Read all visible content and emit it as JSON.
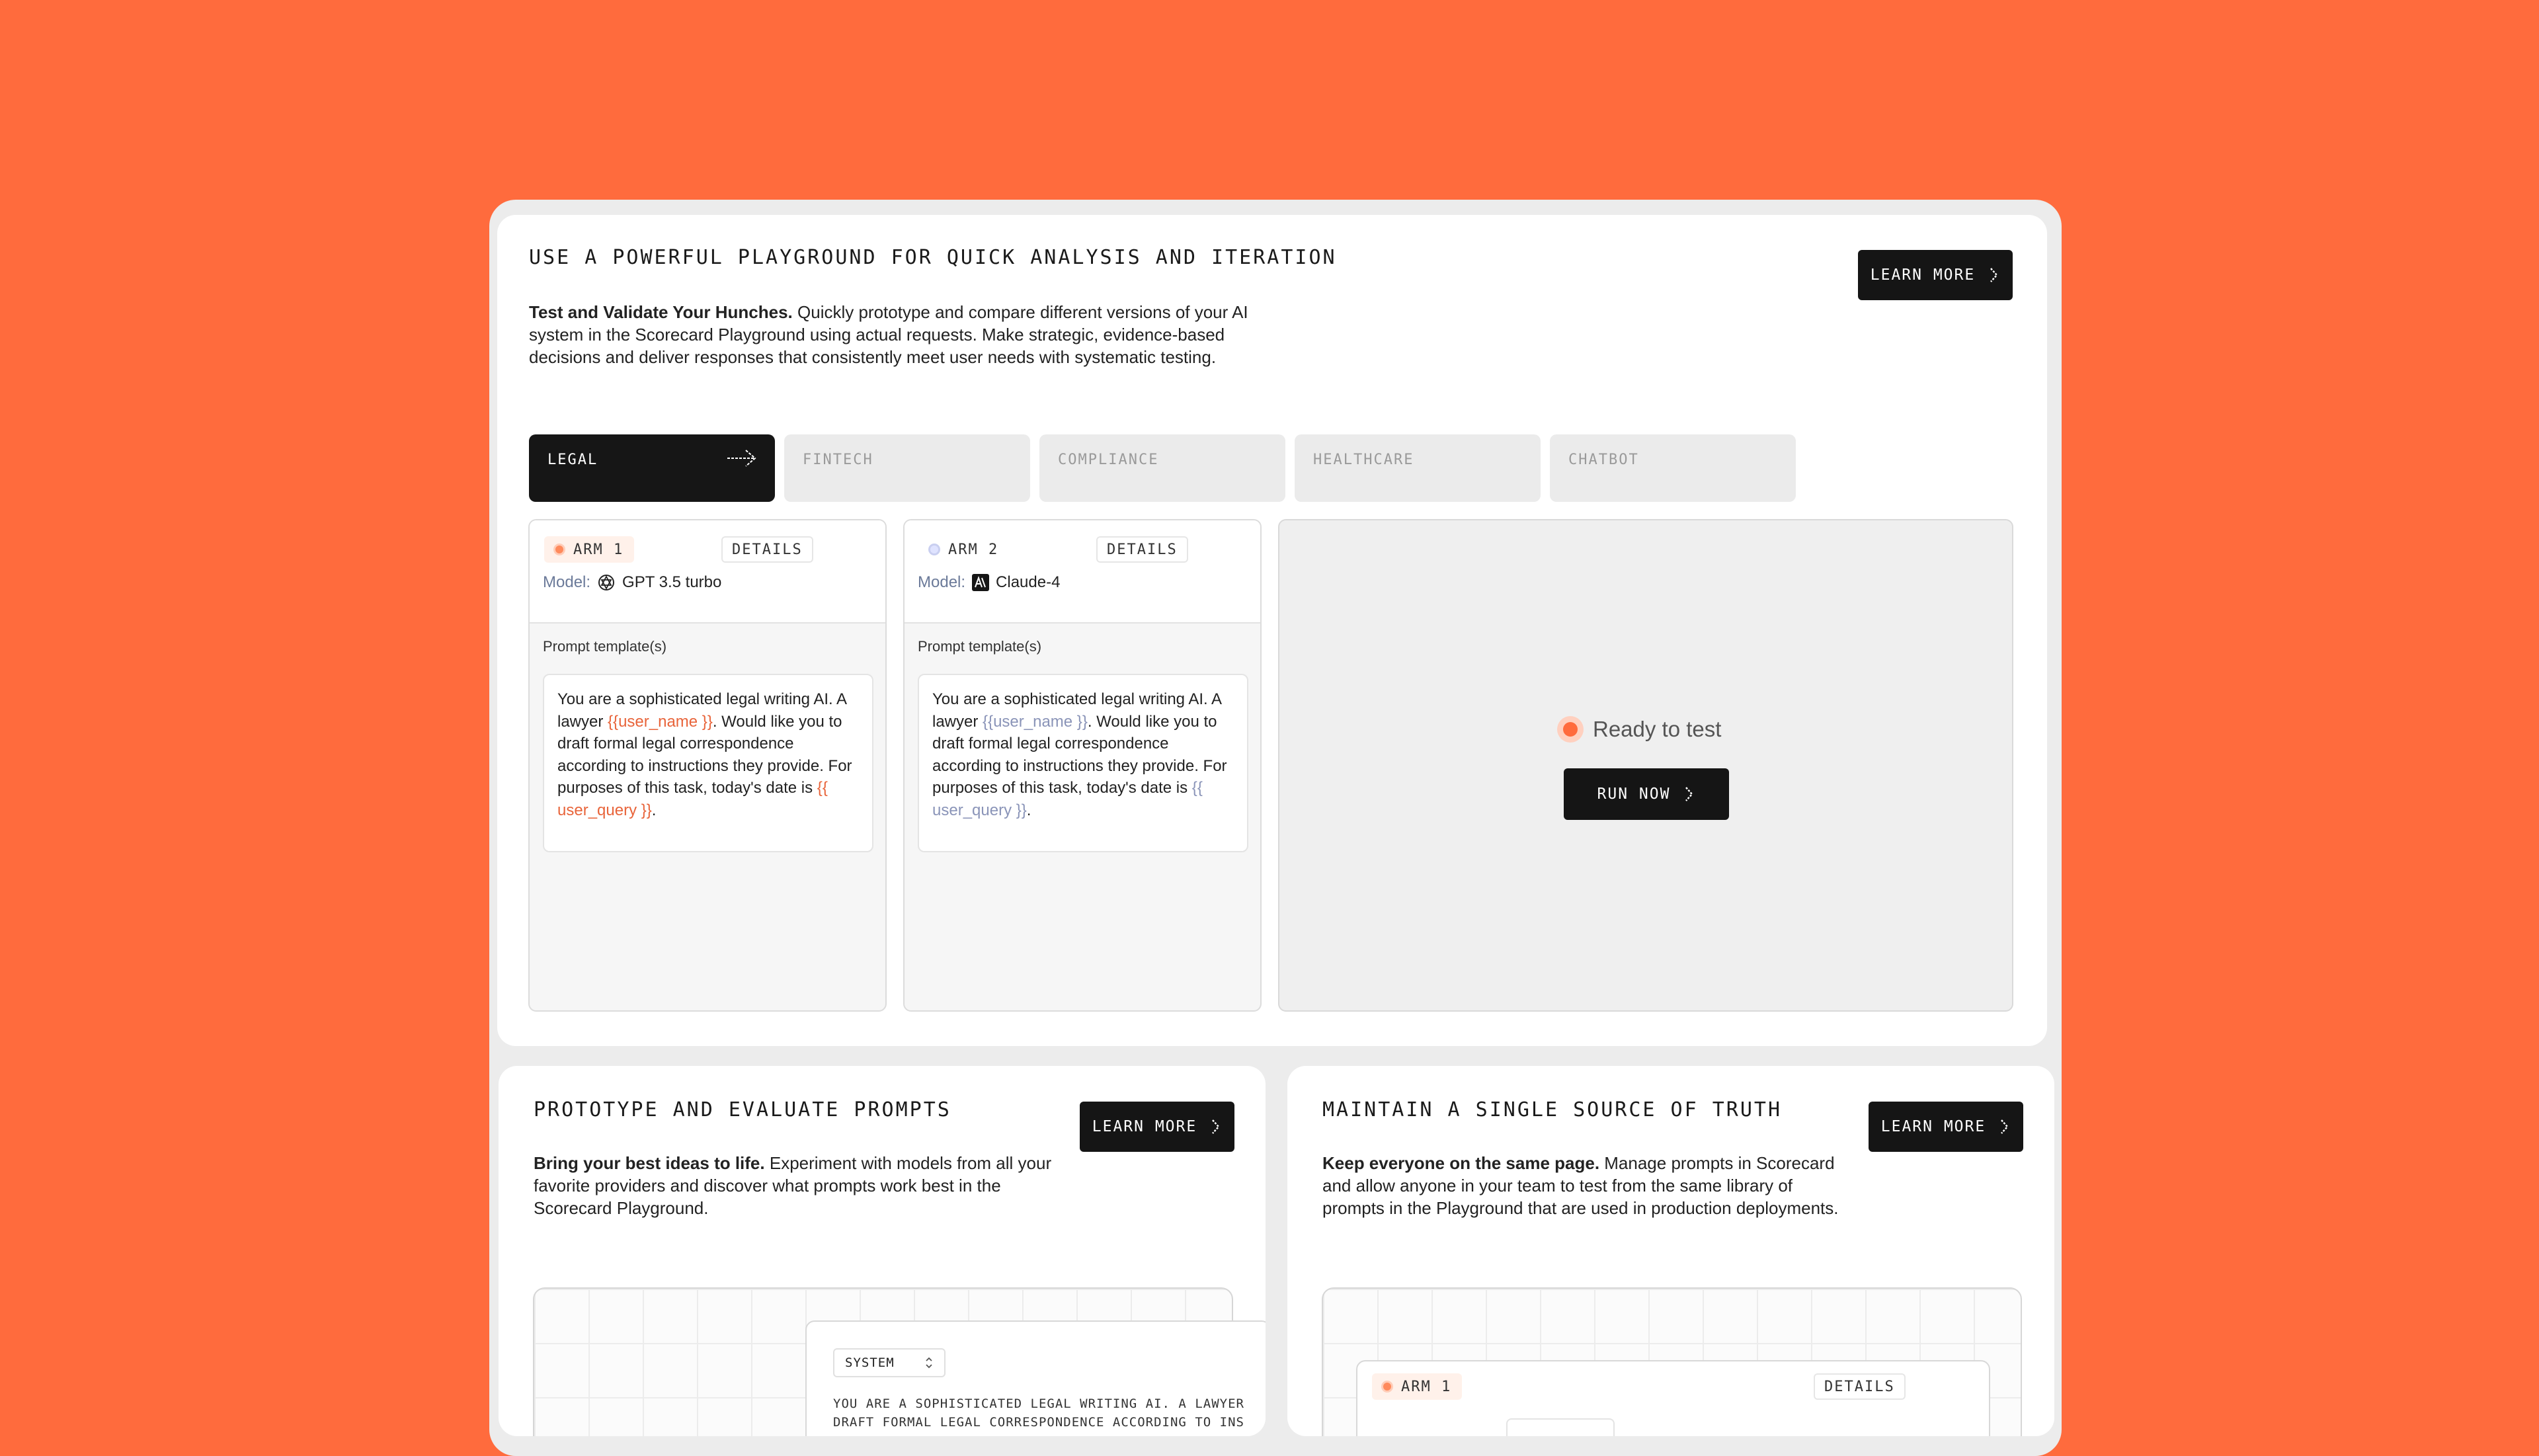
{
  "main": {
    "title": "USE A POWERFUL PLAYGROUND FOR QUICK ANALYSIS AND ITERATION",
    "lead_bold": "Test and Validate Your Hunches.",
    "lead_text": " Quickly prototype and compare different versions of your AI system in the Scorecard Playground using actual requests. Make strategic, evidence-based decisions and deliver responses that consistently meet user needs with systematic testing.",
    "learn_more": "LEARN MORE"
  },
  "tabs": [
    {
      "label": "LEGAL",
      "active": true
    },
    {
      "label": "FINTECH",
      "active": false
    },
    {
      "label": "COMPLIANCE",
      "active": false
    },
    {
      "label": "HEALTHCARE",
      "active": false
    },
    {
      "label": "CHATBOT",
      "active": false
    }
  ],
  "arms": [
    {
      "badge": "ARM 1",
      "details": "DETAILS",
      "model_label": "Model:",
      "model_name": "GPT 3.5 turbo",
      "model_icon": "openai-icon",
      "prompt_label": "Prompt template(s)",
      "prompt_parts": [
        "You are a sophisticated legal writing AI. A lawyer ",
        "{{user_name }}",
        ". Would like you to draft formal legal correspondence according to instructions they provide. For purposes of this task, today's date is ",
        "{{ user_query }}",
        "."
      ],
      "accent": "#e8643a",
      "dot": "#ff8a5c"
    },
    {
      "badge": "ARM 2",
      "details": "DETAILS",
      "model_label": "Model:",
      "model_name": "Claude-4",
      "model_icon": "anthropic-icon",
      "prompt_label": "Prompt template(s)",
      "prompt_parts": [
        "You are a sophisticated legal writing AI. A lawyer ",
        "{{user_name }}",
        ". Would like you to draft formal legal correspondence according to instructions they provide. For purposes of this task, today's date is ",
        "{{ user_query }}",
        "."
      ],
      "accent": "#8a94b8",
      "dot": "#c9cff0"
    }
  ],
  "runner": {
    "status": "Ready to test",
    "run_label": "RUN NOW"
  },
  "card_prototype": {
    "title": "PROTOTYPE AND EVALUATE PROMPTS",
    "lead_bold": "Bring your best ideas to life.",
    "lead_text": " Experiment with models from all your favorite providers and discover what prompts work best in the Scorecard Playground.",
    "learn_more": "LEARN MORE",
    "role_select": "SYSTEM",
    "snippet_line1": "YOU ARE A SOPHISTICATED LEGAL WRITING AI. A LAWYER",
    "snippet_line2": "DRAFT FORMAL LEGAL CORRESPONDENCE ACCORDING TO INS"
  },
  "card_truth": {
    "title": "MAINTAIN A SINGLE SOURCE OF TRUTH",
    "lead_bold": "Keep everyone on the same page.",
    "lead_text": " Manage prompts in Scorecard and allow anyone in your team to test from the same library of prompts in the Playground that are used in production deployments.",
    "learn_more": "LEARN MORE",
    "arm_badge": "ARM 1",
    "details": "DETAILS"
  },
  "colors": {
    "background": "#ff6b3d",
    "dark": "#151515",
    "accent": "#ff6b3d"
  }
}
